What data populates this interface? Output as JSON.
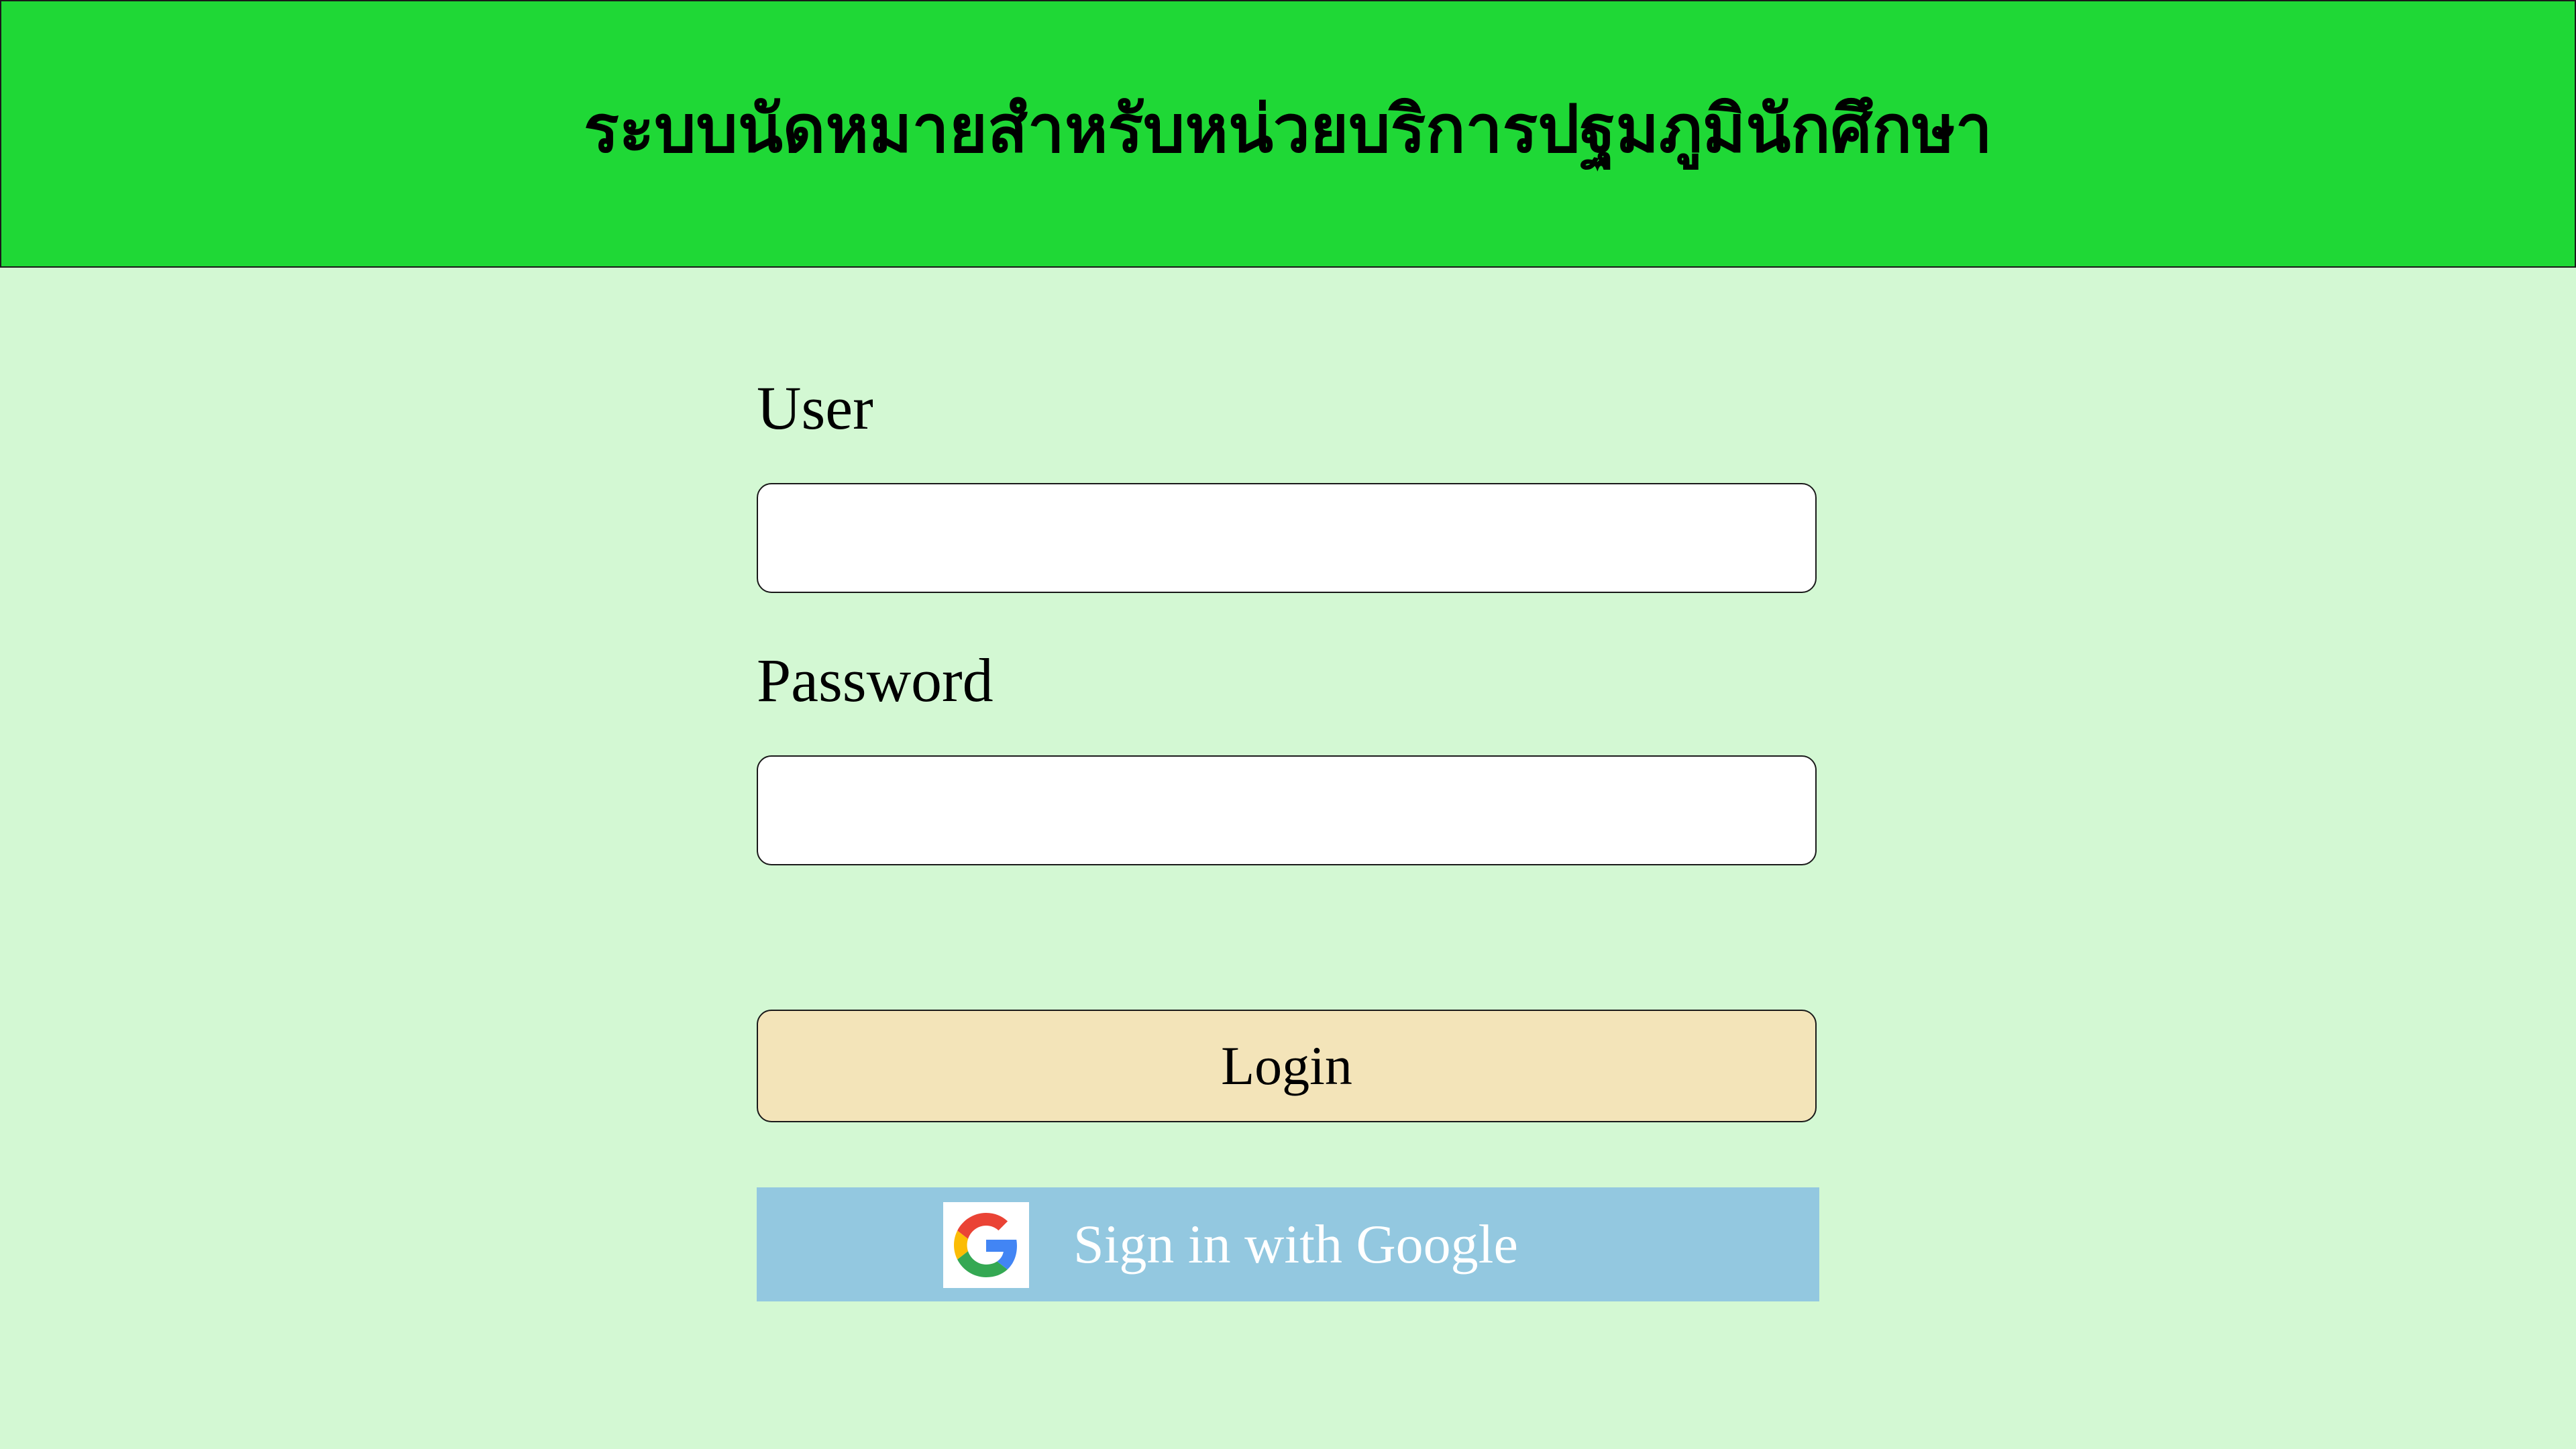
{
  "header": {
    "title": "ระบบนัดหมายสำหรับหน่วยบริการปฐมภูมินักศึกษา"
  },
  "form": {
    "user_label": "User",
    "user_value": "",
    "password_label": "Password",
    "password_value": "",
    "login_label": "Login",
    "google_label": "Sign in with Google",
    "google_icon": "google-g-icon"
  },
  "colors": {
    "header_bg": "#1fd836",
    "page_bg": "#d3f8d3",
    "login_bg": "#f3e4b9",
    "google_bg": "#93c8e0"
  }
}
